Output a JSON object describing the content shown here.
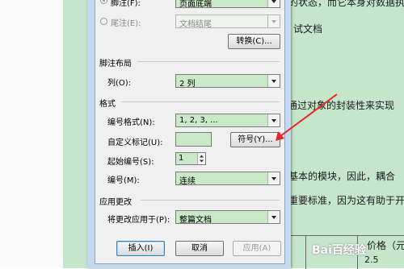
{
  "document": {
    "text_line1": "的状态，而它本身对数据执行",
    "text_line2": "试文档",
    "text_line3": "通过对象的封装性来实现",
    "text_line4": "基本的模块，因此，耦合",
    "text_line5": "重要标准，因为这有助于开",
    "table_header": "价格（元",
    "table_value": "2.5"
  },
  "dialog": {
    "location": {
      "footnote_label": "脚注(F):",
      "footnote_value": "页面底端",
      "endnote_label": "尾注(E):",
      "endnote_value": "文档结尾",
      "convert_button": "转换(C)..."
    },
    "layout": {
      "section_title": "脚注布局",
      "columns_label": "列(O):",
      "columns_value": "2 列"
    },
    "format": {
      "section_title": "格式",
      "number_format_label": "编号格式(N):",
      "number_format_value": "1, 2, 3, ...",
      "custom_mark_label": "自定义标记(U):",
      "custom_mark_value": "",
      "symbol_button": "符号(Y)...",
      "start_at_label": "起始编号(S):",
      "start_at_value": "1",
      "numbering_label": "编号(M):",
      "numbering_value": "连续"
    },
    "apply": {
      "section_title": "应用更改",
      "apply_to_label": "将更改应用于(P):",
      "apply_to_value": "整篇文档"
    },
    "buttons": {
      "insert": "插入(I)",
      "cancel": "取消",
      "apply": "应用(A)"
    }
  },
  "annotation": {
    "arrow_color": "#e8262b"
  },
  "watermark": {
    "text": "Bai百经验"
  }
}
